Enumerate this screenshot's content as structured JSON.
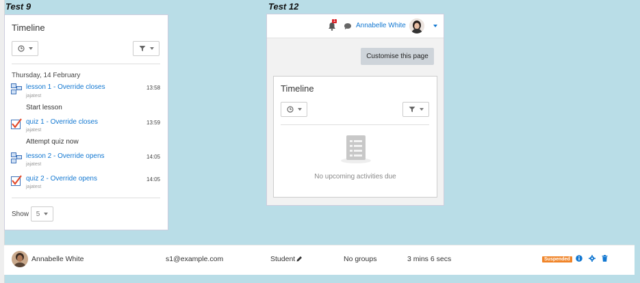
{
  "labels": {
    "test9": "Test 9",
    "test12": "Test 12"
  },
  "left_card": {
    "title": "Timeline",
    "date_heading": "Thursday, 14 February",
    "items": [
      {
        "icon": "lesson-icon",
        "title": "lesson 1 - Override closes",
        "course": "jajatest",
        "time": "13:58",
        "action": "Start lesson"
      },
      {
        "icon": "quiz-icon",
        "title": "quiz 1 - Override closes",
        "course": "jajatest",
        "time": "13:59",
        "action": "Attempt quiz now"
      },
      {
        "icon": "lesson-icon",
        "title": "lesson 2 - Override opens",
        "course": "jajatest",
        "time": "14:05",
        "action": ""
      },
      {
        "icon": "quiz-icon",
        "title": "quiz 2 - Override opens",
        "course": "jajatest",
        "time": "14:05",
        "action": ""
      }
    ],
    "show_label": "Show",
    "show_value": "5"
  },
  "right_panel": {
    "notification_count": "1",
    "user_name": "Annabelle White",
    "customise_button": "Customise this page",
    "timeline_title": "Timeline",
    "empty_message": "No upcoming activities due"
  },
  "user_row": {
    "name": "Annabelle White",
    "email": "s1@example.com",
    "role": "Student",
    "groups": "No groups",
    "last_access": "3 mins 6 secs",
    "status": "Suspended"
  },
  "colors": {
    "accent": "#1177d1",
    "background": "#b9dde7",
    "suspended": "#f0852a",
    "badge": "#d9242a"
  }
}
